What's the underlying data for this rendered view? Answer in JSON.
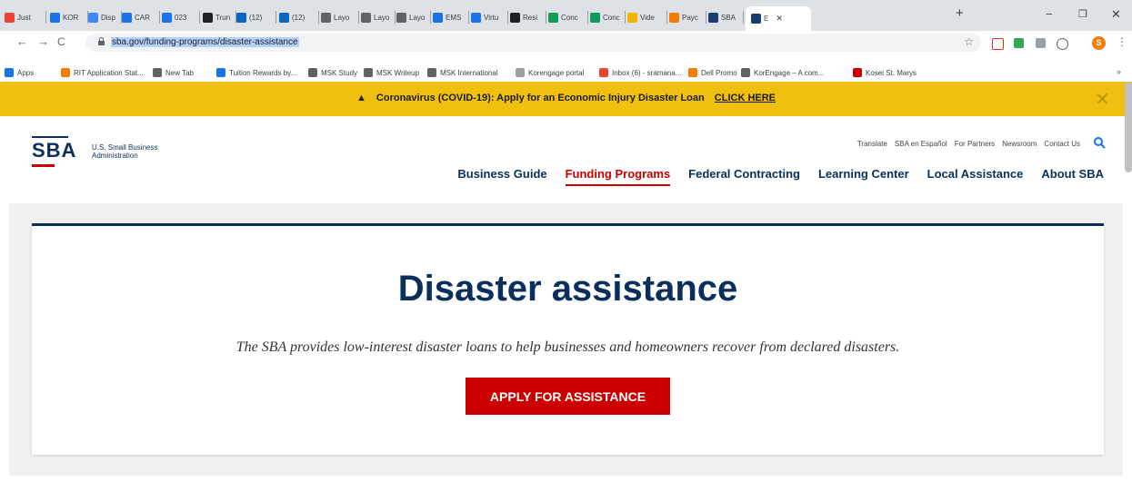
{
  "browser": {
    "tabs": [
      {
        "label": "Just",
        "icon": "gmail-icon",
        "color": "#ea4335"
      },
      {
        "label": "KOR",
        "icon": "calendar-icon",
        "color": "#1a73e8"
      },
      {
        "label": "Disp",
        "icon": "google-icon",
        "color": "#4285f4"
      },
      {
        "label": "CAR",
        "icon": "doc-icon",
        "color": "#1a73e8"
      },
      {
        "label": "023",
        "icon": "image-icon",
        "color": "#1a73e8"
      },
      {
        "label": "Trun",
        "icon": "news-icon",
        "color": "#202124"
      },
      {
        "label": "(12)",
        "icon": "linkedin-icon",
        "color": "#0a66c2"
      },
      {
        "label": "(12)",
        "icon": "linkedin-icon",
        "color": "#0a66c2"
      },
      {
        "label": "Layo",
        "icon": "globe-icon",
        "color": "#5f6368"
      },
      {
        "label": "Layo",
        "icon": "globe-icon",
        "color": "#5f6368"
      },
      {
        "label": "Layo",
        "icon": "globe-icon",
        "color": "#5f6368"
      },
      {
        "label": "EMS",
        "icon": "ems-icon",
        "color": "#1a73e8"
      },
      {
        "label": "Virtu",
        "icon": "video-icon",
        "color": "#1a73e8"
      },
      {
        "label": "Resi",
        "icon": "d-icon",
        "color": "#202124"
      },
      {
        "label": "Conc",
        "icon": "cr-icon",
        "color": "#0f9d58"
      },
      {
        "label": "Conc",
        "icon": "cr-icon",
        "color": "#0f9d58"
      },
      {
        "label": "Vide",
        "icon": "circle-icon",
        "color": "#f4b400"
      },
      {
        "label": "Payc",
        "icon": "play-icon",
        "color": "#f57c00"
      },
      {
        "label": "SBA",
        "icon": "sba-icon",
        "color": "#1a3c6e"
      },
      {
        "label": "E",
        "icon": "sba-icon",
        "color": "#1a3c6e"
      }
    ],
    "url": "sba.gov/funding-programs/disaster-assistance",
    "bookmarks": [
      {
        "label": "Apps",
        "icon": "apps-icon",
        "color": "#1a73e8"
      },
      {
        "label": "RIT Application Stat...",
        "icon": "rit-icon",
        "color": "#f57c00"
      },
      {
        "label": "New Tab",
        "icon": "globe-icon",
        "color": "#5f6368"
      },
      {
        "label": "Tuition Rewards by...",
        "icon": "tuition-icon",
        "color": "#1a73e8"
      },
      {
        "label": "MSK Study",
        "icon": "info-icon",
        "color": "#5f6368"
      },
      {
        "label": "MSK Writeup",
        "icon": "info-icon",
        "color": "#5f6368"
      },
      {
        "label": "MSK International",
        "icon": "info-icon",
        "color": "#5f6368"
      },
      {
        "label": "Korengage portal",
        "icon": "portal-icon",
        "color": "#9aa0a6"
      },
      {
        "label": "Inbox (6) - sramana...",
        "icon": "gmail-icon",
        "color": "#ea4335"
      },
      {
        "label": "Dell Promo",
        "icon": "dell-icon",
        "color": "#f57c00"
      },
      {
        "label": "KorEngage – A com...",
        "icon": "globe-icon",
        "color": "#5f6368"
      },
      {
        "label": "Kosei St. Marys",
        "icon": "kosei-icon",
        "color": "#cc0000"
      }
    ],
    "profile_initial": "S"
  },
  "banner": {
    "text": "Coronavirus (COVID-19): Apply for an Economic Injury Disaster Loan",
    "link": "CLICK HERE"
  },
  "header": {
    "logo_text": "SBA",
    "org_line1": "U.S. Small Business",
    "org_line2": "Administration",
    "util_links": [
      "Translate",
      "SBA en Español",
      "For Partners",
      "Newsroom",
      "Contact Us"
    ],
    "nav": [
      "Business Guide",
      "Funding Programs",
      "Federal Contracting",
      "Learning Center",
      "Local Assistance",
      "About SBA"
    ],
    "active_nav": "Funding Programs"
  },
  "hero": {
    "title": "Disaster assistance",
    "subtitle": "The SBA provides low-interest disaster loans to help businesses and homeowners recover from declared disasters.",
    "button": "APPLY FOR ASSISTANCE"
  },
  "colors": {
    "brand_blue": "#0b2f5c",
    "brand_red": "#cc0000",
    "banner_yellow": "#f0c010"
  }
}
